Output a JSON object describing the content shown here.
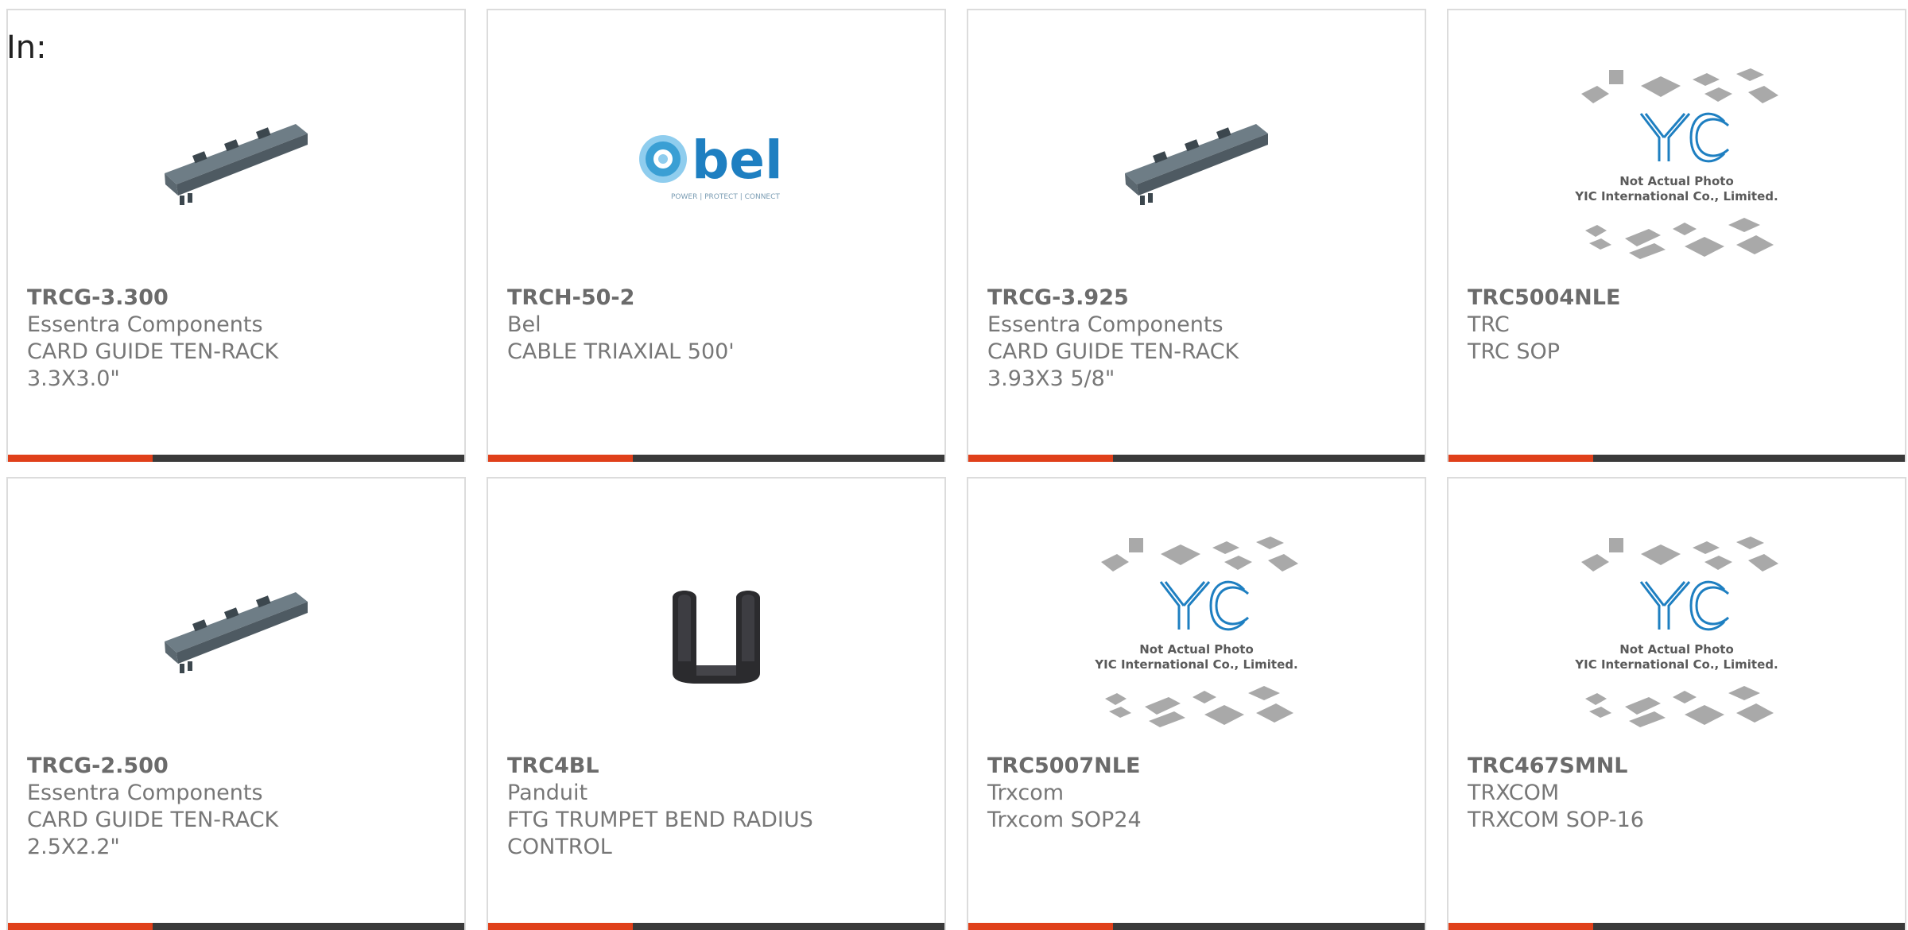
{
  "header": {
    "label": "In:"
  },
  "products": [
    {
      "part": "TRCG-3.300",
      "maker": "Essentra Components",
      "desc": "CARD GUIDE TEN-RACK 3.3X3.0\"",
      "image": "card-guide-rail"
    },
    {
      "part": "TRCH-50-2",
      "maker": "Bel",
      "desc": "CABLE TRIAXIAL 500'",
      "image": "bel-logo"
    },
    {
      "part": "TRCG-3.925",
      "maker": "Essentra Components",
      "desc": "CARD GUIDE TEN-RACK 3.93X3 5/8\"",
      "image": "card-guide-rail"
    },
    {
      "part": "TRC5004NLE",
      "maker": "TRC",
      "desc": "TRC SOP",
      "image": "yic-placeholder"
    },
    {
      "part": "TRCG-2.500",
      "maker": "Essentra Components",
      "desc": "CARD GUIDE TEN-RACK 2.5X2.2\"",
      "image": "card-guide-rail"
    },
    {
      "part": "TRC4BL",
      "maker": "Panduit",
      "desc": "FTG TRUMPET BEND RADIUS CONTROL",
      "image": "trumpet-bend-fitting"
    },
    {
      "part": "TRC5007NLE",
      "maker": "Trxcom",
      "desc": "Trxcom SOP24",
      "image": "yic-placeholder"
    },
    {
      "part": "TRC467SMNL",
      "maker": "TRXCOM",
      "desc": "TRXCOM SOP-16",
      "image": "yic-placeholder"
    }
  ],
  "logos": {
    "bel": {
      "wordmark": "bel",
      "tagline": "POWER | PROTECT | CONNECT"
    },
    "yic": {
      "line1": "Not Actual Photo",
      "line2": "YIC International Co., Limited."
    }
  },
  "colors": {
    "accent": "#e0401a",
    "bar": "#3a3a3a",
    "bel_blue": "#1e7fc1"
  }
}
